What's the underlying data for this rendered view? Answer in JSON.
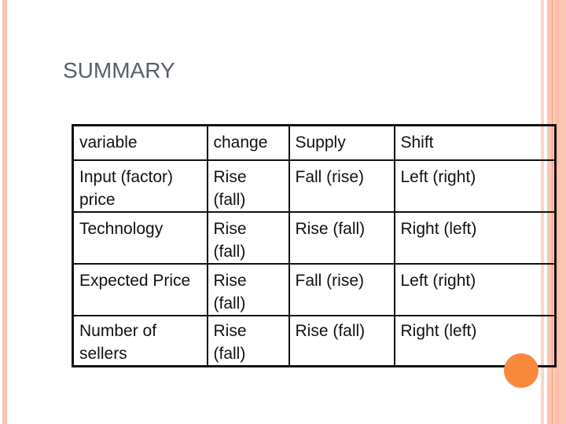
{
  "slide": {
    "title": "SUMMARY",
    "accent_colors": {
      "border_stripe": "#fbc4b2",
      "border_line": "#f2a07f",
      "dot": "#f98a3d",
      "title_text": "#575f68"
    }
  },
  "table": {
    "headers": [
      "variable",
      "change",
      "Supply",
      "Shift"
    ],
    "rows": [
      [
        "Input (factor) price",
        "Rise (fall)",
        "Fall (rise)",
        "Left (right)"
      ],
      [
        "Technology",
        "Rise (fall)",
        "Rise (fall)",
        "Right (left)"
      ],
      [
        "Expected Price",
        "Rise (fall)",
        "Fall (rise)",
        "Left (right)"
      ],
      [
        "Number of sellers",
        "Rise (fall)",
        "Rise (fall)",
        "Right (left)"
      ]
    ]
  },
  "decorations": {
    "corner_dot_icon": "orange-circle"
  }
}
